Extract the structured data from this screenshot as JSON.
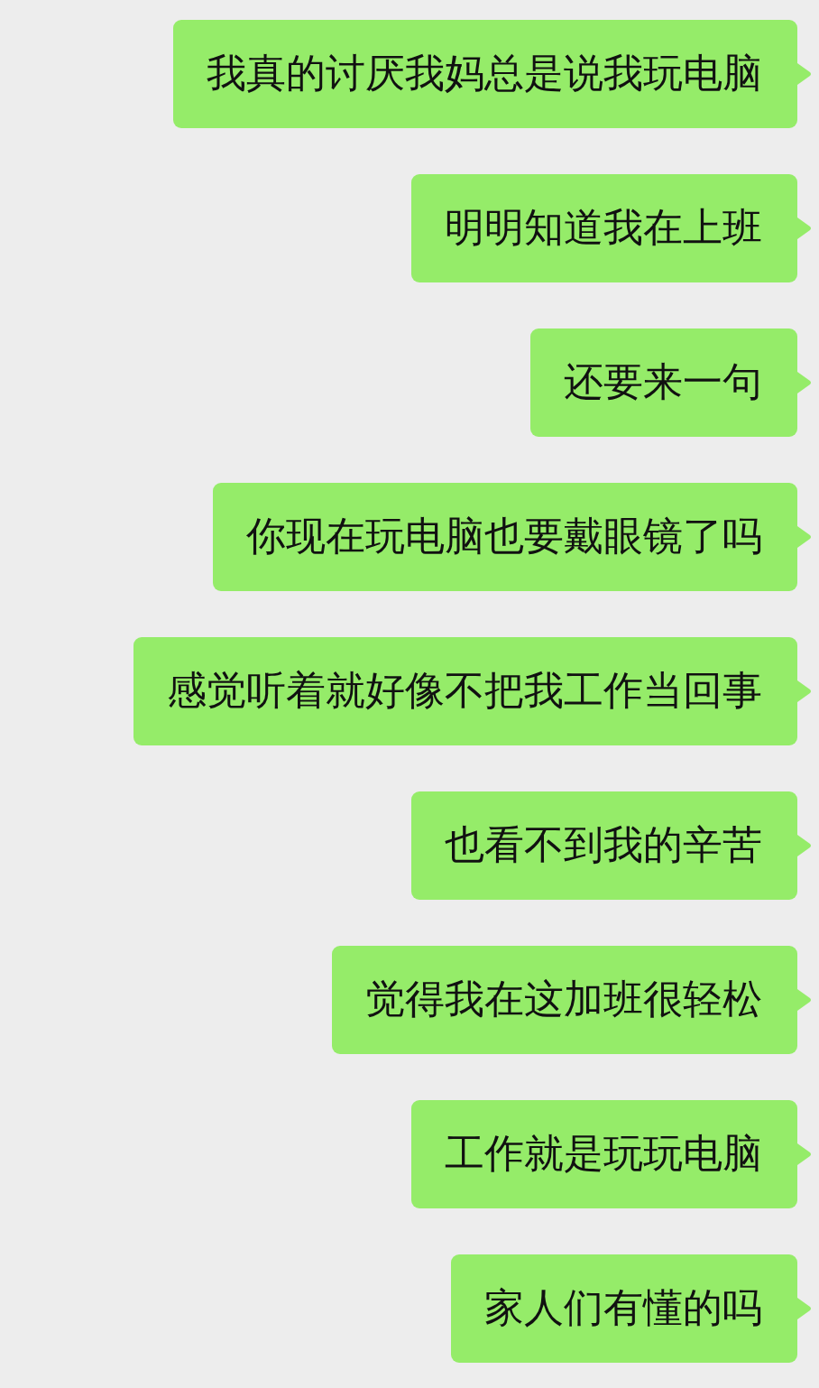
{
  "messages": [
    {
      "text": "我真的讨厌我妈总是说我玩电脑"
    },
    {
      "text": "明明知道我在上班"
    },
    {
      "text": "还要来一句"
    },
    {
      "text": "你现在玩电脑也要戴眼镜了吗"
    },
    {
      "text": "感觉听着就好像不把我工作当回事"
    },
    {
      "text": "也看不到我的辛苦"
    },
    {
      "text": "觉得我在这加班很轻松"
    },
    {
      "text": "工作就是玩玩电脑"
    },
    {
      "text": "家人们有懂的吗"
    }
  ]
}
